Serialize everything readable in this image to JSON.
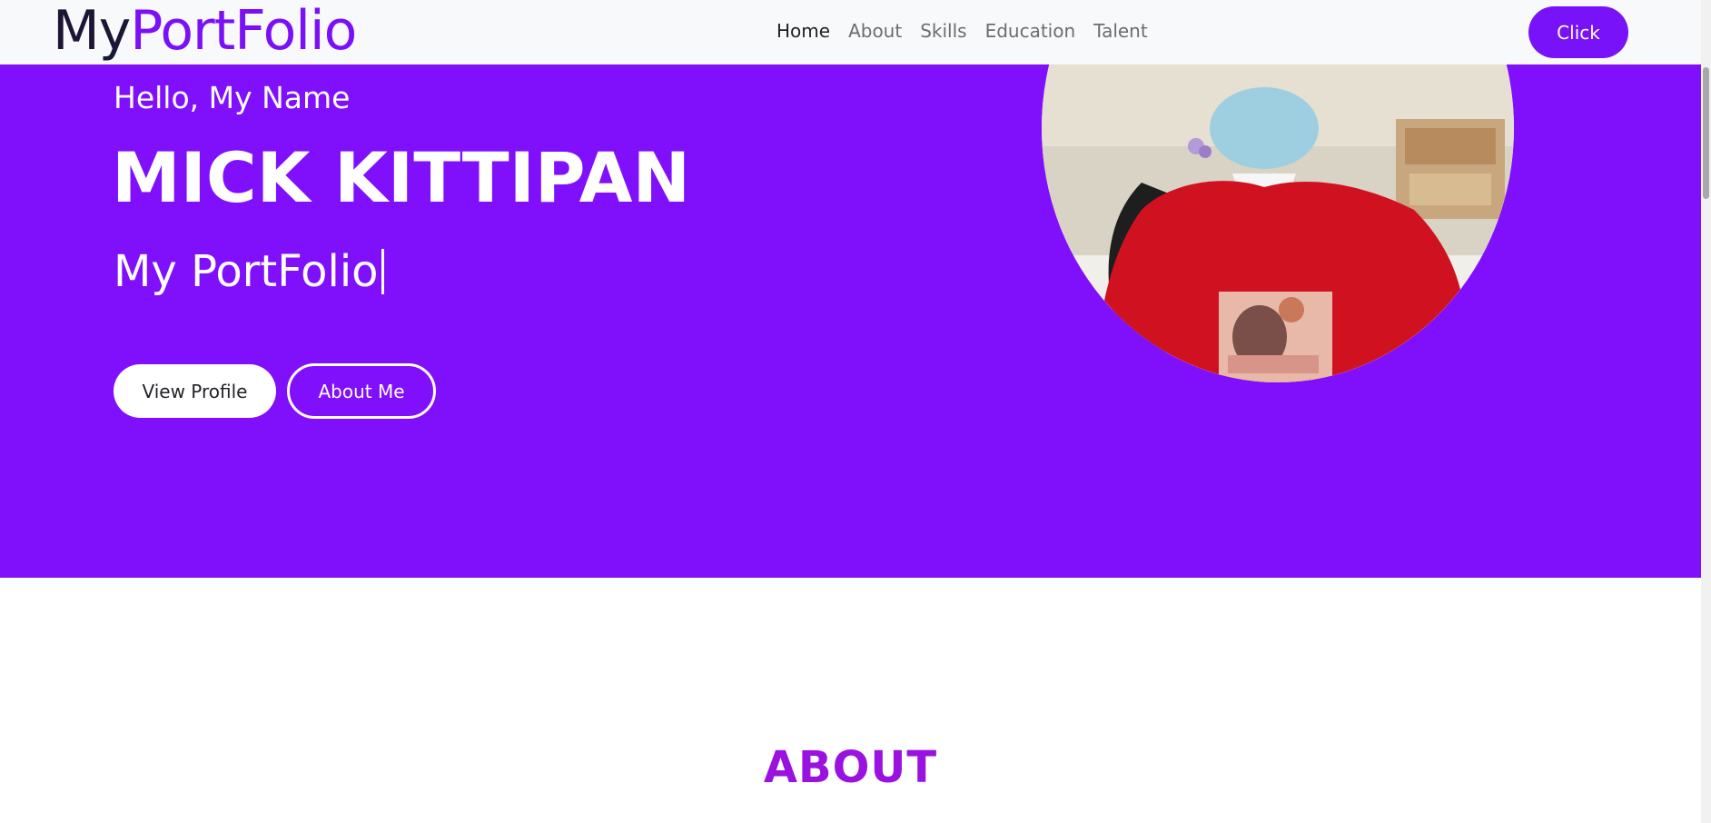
{
  "navbar": {
    "brand_part1": "My",
    "brand_part2": "PortFolio",
    "links": [
      "Home",
      "About",
      "Skills",
      "Education",
      "Talent"
    ],
    "active_link": "Home",
    "cta_label": "Click"
  },
  "hero": {
    "greeting": "Hello, My Name",
    "name": "MICK KITTIPAN",
    "typed_text": "My PortFolio",
    "primary_button": "View Profile",
    "secondary_button": "About Me",
    "background_color": "#800ffc"
  },
  "about": {
    "heading": "ABOUT"
  },
  "colors": {
    "accent": "#7812f8",
    "brand_dark": "#1c1535",
    "about_heading": "#9a12e0"
  }
}
